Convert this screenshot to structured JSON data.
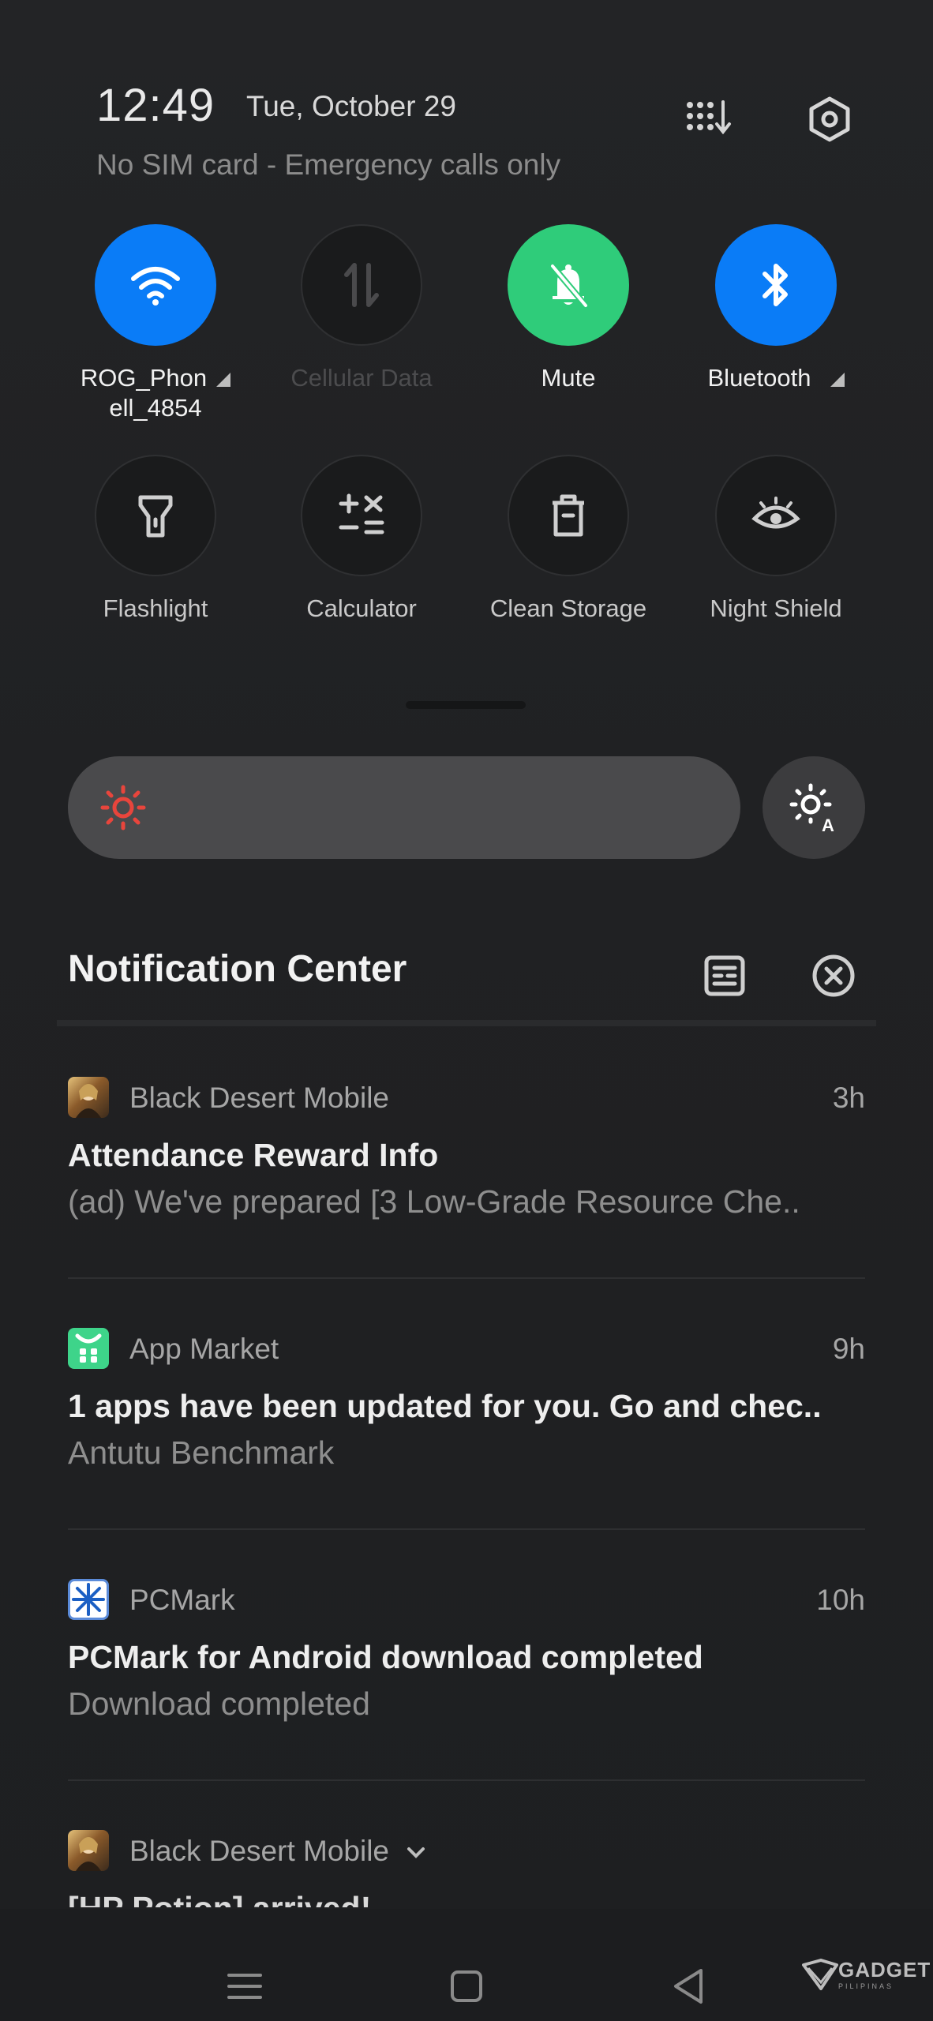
{
  "status": {
    "time": "12:49",
    "date": "Tue, October 29",
    "sim_status": "No SIM card - Emergency calls only"
  },
  "header_icons": {
    "tile_editor": "tile-grid-edit-icon",
    "settings": "settings-hexagon-icon"
  },
  "tiles": [
    {
      "label": "ROG_Phon",
      "label_line2": "ell_4854",
      "state": "on",
      "icon": "wifi-icon",
      "has_expand": true
    },
    {
      "label": "Cellular Data",
      "state": "disabled",
      "icon": "data-arrows-icon"
    },
    {
      "label": "Mute",
      "state": "on",
      "icon": "bell-off-icon"
    },
    {
      "label": "Bluetooth",
      "state": "on",
      "icon": "bluetooth-icon",
      "has_expand": true
    },
    {
      "label": "Flashlight",
      "state": "off",
      "icon": "flashlight-icon"
    },
    {
      "label": "Calculator",
      "state": "off",
      "icon": "calculator-icon"
    },
    {
      "label": "Clean Storage",
      "state": "off",
      "icon": "trash-icon"
    },
    {
      "label": "Night Shield",
      "state": "off",
      "icon": "eye-icon"
    }
  ],
  "brightness": {
    "level": 0.0,
    "icon": "sun-icon",
    "auto_icon": "auto-brightness-icon"
  },
  "notification_center": {
    "title": "Notification Center",
    "notifications": [
      {
        "app": "Black Desert Mobile",
        "time": "3h",
        "title": "Attendance Reward Info",
        "body": "(ad) We've prepared [3 Low-Grade Resource Che.."
      },
      {
        "app": "App Market",
        "time": "9h",
        "title": "1 apps have been updated for you. Go and chec..",
        "body": "Antutu Benchmark"
      },
      {
        "app": "PCMark",
        "time": "10h",
        "title": "PCMark for Android download completed",
        "body": "Download completed"
      },
      {
        "app": "Black Desert Mobile",
        "title": "[HP Potion] arrived!"
      }
    ]
  },
  "watermark": {
    "text": "GADGET",
    "sub": "PILIPINAS"
  },
  "colors": {
    "accent_blue": "#0a7cf7",
    "mute_green": "#2fcc7a",
    "brightness_sun": "#e8453c",
    "background": "#202123"
  }
}
